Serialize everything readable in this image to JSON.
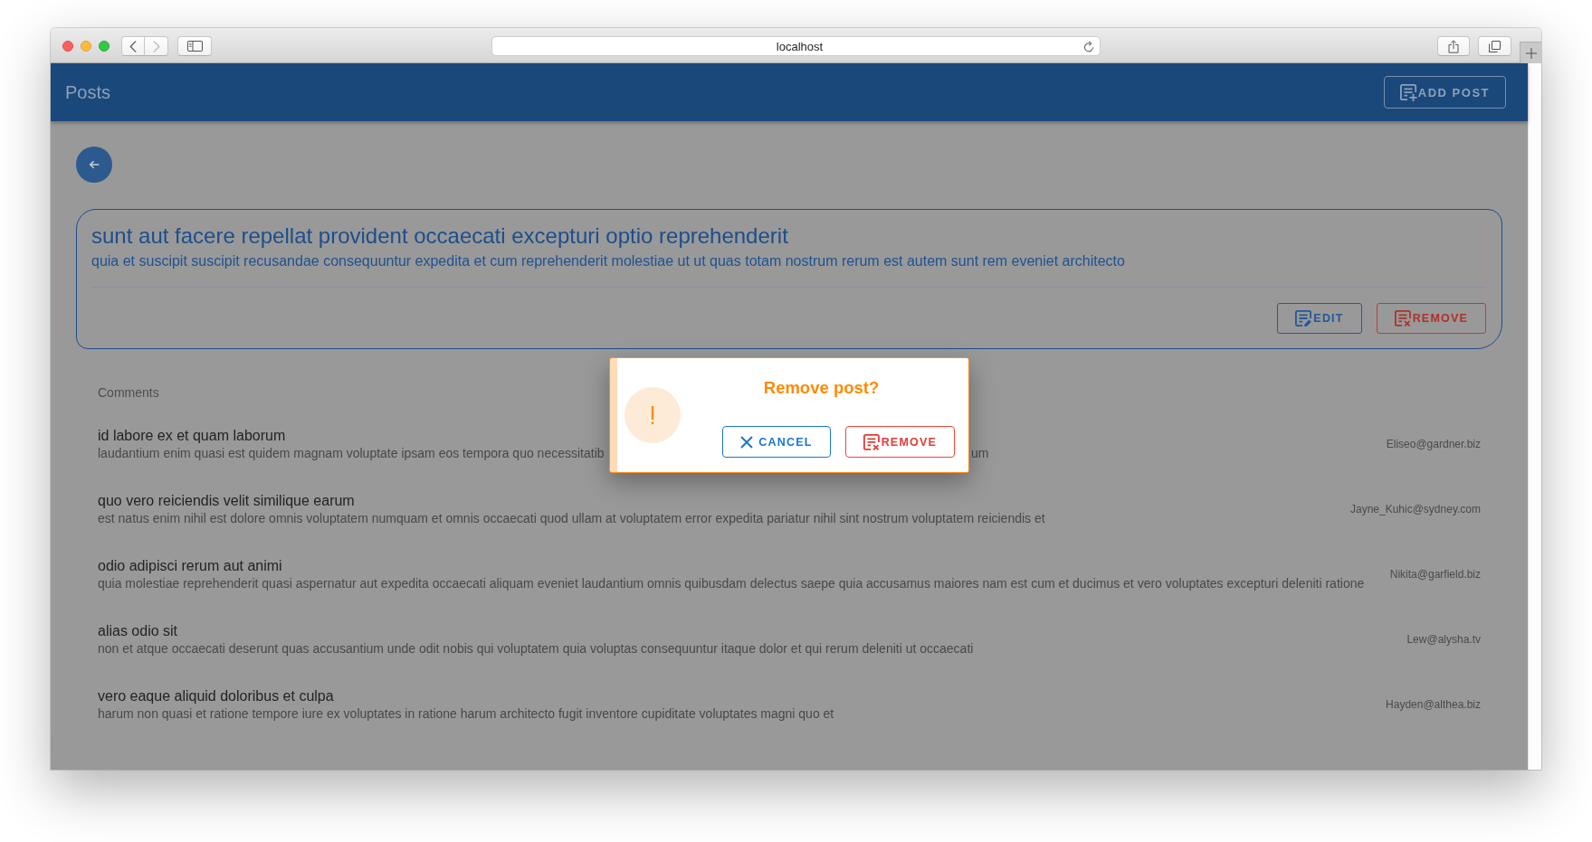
{
  "browser": {
    "url": "localhost"
  },
  "app_bar": {
    "title": "Posts",
    "add_button": "ADD POST"
  },
  "post": {
    "title": "sunt aut facere repellat provident occaecati excepturi optio reprehenderit",
    "body": "quia et suscipit suscipit recusandae consequuntur expedita et cum reprehenderit molestiae ut ut quas totam nostrum rerum est autem sunt rem eveniet architecto",
    "actions": [
      {
        "kind": "edit",
        "label": "EDIT"
      },
      {
        "kind": "remove",
        "label": "REMOVE"
      }
    ]
  },
  "comments": {
    "heading": "Comments",
    "items": [
      {
        "name": "id labore ex et quam laborum",
        "body_parts": [
          "laudantium enim quasi est quidem magnam voluptate ipsam eos tempora quo necessitatib",
          "um"
        ],
        "email": "Eliseo@gardner.biz"
      },
      {
        "name": "quo vero reiciendis velit similique earum",
        "body_parts": [
          "est natus enim nihil est dolore omnis voluptatem numquam et omnis occaecati quod ullam at voluptatem error expedita pariatur nihil sint nostrum voluptatem reiciendis et"
        ],
        "email": "Jayne_Kuhic@sydney.com"
      },
      {
        "name": "odio adipisci rerum aut animi",
        "body_parts": [
          "quia molestiae reprehenderit quasi aspernatur aut expedita occaecati aliquam eveniet laudantium omnis quibusdam delectus saepe quia accusamus maiores nam est cum et ducimus et vero voluptates excepturi deleniti ratione"
        ],
        "email": "Nikita@garfield.biz"
      },
      {
        "name": "alias odio sit",
        "body_parts": [
          "non et atque occaecati deserunt quas accusantium unde odit nobis qui voluptatem quia voluptas consequuntur itaque dolor et qui rerum deleniti ut occaecati"
        ],
        "email": "Lew@alysha.tv"
      },
      {
        "name": "vero eaque aliquid doloribus et culpa",
        "body_parts": [
          "harum non quasi et ratione tempore iure ex voluptates in ratione harum architecto fugit inventore cupiditate voluptates magni quo et"
        ],
        "email": "Hayden@althea.biz"
      }
    ]
  },
  "dialog": {
    "title": "Remove post?",
    "buttons": [
      {
        "kind": "cancel",
        "label": "CANCEL"
      },
      {
        "kind": "remove",
        "label": "REMOVE"
      }
    ]
  }
}
